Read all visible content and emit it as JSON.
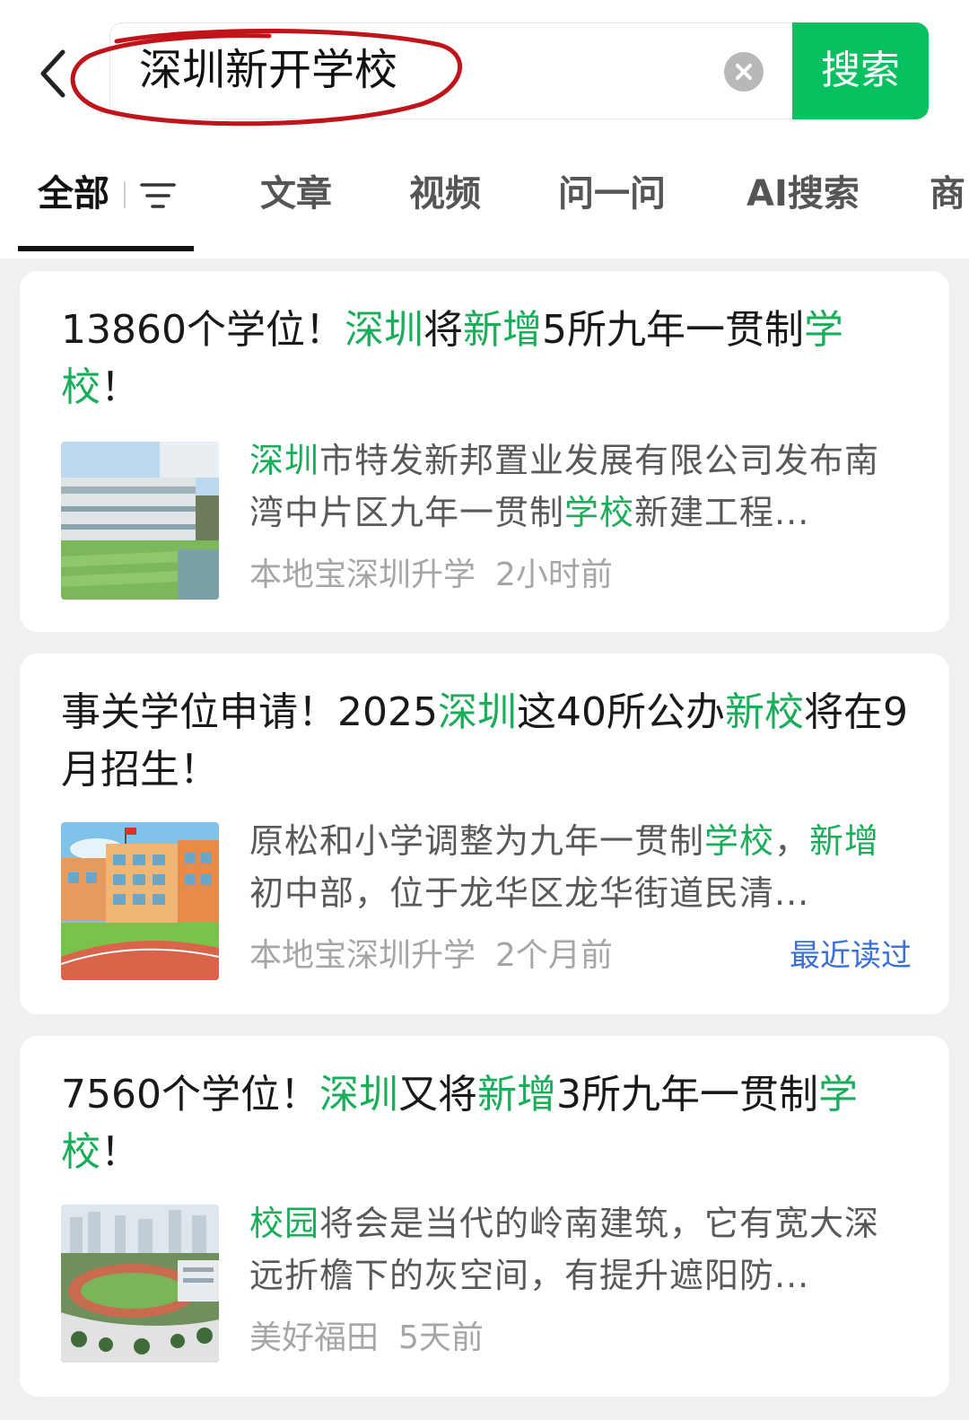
{
  "search": {
    "query": "深圳新开学校",
    "button_label": "搜索"
  },
  "tabs": [
    {
      "label": "全部",
      "active": true
    },
    {
      "label": "文章"
    },
    {
      "label": "视频"
    },
    {
      "label": "问一问"
    },
    {
      "label": "AI搜索"
    },
    {
      "label": "商"
    }
  ],
  "results": [
    {
      "title_segments": [
        {
          "text": "13860个学位！",
          "hl": false
        },
        {
          "text": "深圳",
          "hl": true
        },
        {
          "text": "将",
          "hl": false
        },
        {
          "text": "新增",
          "hl": true
        },
        {
          "text": "5所九年一贯制",
          "hl": false
        },
        {
          "text": "学校",
          "hl": true
        },
        {
          "text": "！",
          "hl": false
        }
      ],
      "desc_segments": [
        {
          "text": "深圳",
          "hl": true
        },
        {
          "text": "市特发新邦置业发展有限公司发布南湾中片区九年一贯制",
          "hl": false
        },
        {
          "text": "学校",
          "hl": true
        },
        {
          "text": "新建工程...",
          "hl": false
        }
      ],
      "source": "本地宝深圳升学",
      "time": "2小时前",
      "thumb": "school-building-rendering"
    },
    {
      "title_segments": [
        {
          "text": "事关学位申请！2025",
          "hl": false
        },
        {
          "text": "深圳",
          "hl": true
        },
        {
          "text": "这40所公办",
          "hl": false
        },
        {
          "text": "新校",
          "hl": true
        },
        {
          "text": "将在9月招生！",
          "hl": false
        }
      ],
      "desc_segments": [
        {
          "text": "原松和小学调整为九年一贯制",
          "hl": false
        },
        {
          "text": "学校",
          "hl": true
        },
        {
          "text": "，",
          "hl": false
        },
        {
          "text": "新增",
          "hl": true
        },
        {
          "text": "初中部，位于龙华区龙华街道民清...",
          "hl": false
        }
      ],
      "source": "本地宝深圳升学",
      "time": "2个月前",
      "badge": "最近读过",
      "thumb": "cartoon-school-with-track"
    },
    {
      "title_segments": [
        {
          "text": "7560个学位！",
          "hl": false
        },
        {
          "text": "深圳",
          "hl": true
        },
        {
          "text": "又将",
          "hl": false
        },
        {
          "text": "新增",
          "hl": true
        },
        {
          "text": "3所九年一贯制",
          "hl": false
        },
        {
          "text": "学校",
          "hl": true
        },
        {
          "text": "！",
          "hl": false
        }
      ],
      "desc_segments": [
        {
          "text": "校园",
          "hl": true
        },
        {
          "text": "将会是当代的岭南建筑，它有宽大深远折檐下的灰空间，有提升遮阳防...",
          "hl": false
        }
      ],
      "source": "美好福田",
      "time": "5天前",
      "thumb": "aerial-campus-rendering"
    }
  ],
  "colors": {
    "accent": "#07c160",
    "highlight": "#1aad5a",
    "recent_badge": "#3a6fd8"
  }
}
